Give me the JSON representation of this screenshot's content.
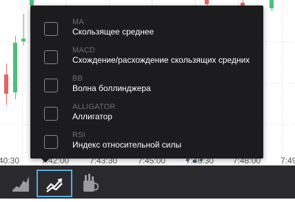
{
  "time_axis": {
    "ticks": [
      "40:30",
      "7:42:00",
      "7:43:30",
      "7:45:00",
      "7:46:30",
      "7:48:00",
      "7:49"
    ]
  },
  "indicator_menu": {
    "items": [
      {
        "code": "MA",
        "name": "Скользящее среднее",
        "checked": false
      },
      {
        "code": "MACD",
        "name": "Схождение/расхождение скользящих средних",
        "checked": false
      },
      {
        "code": "BB",
        "name": "Волна боллинджера",
        "checked": false
      },
      {
        "code": "ALLIGATOR",
        "name": "Аллигатор",
        "checked": false
      },
      {
        "code": "RSI",
        "name": "Индекс относительной силы",
        "checked": false
      }
    ]
  },
  "toolbar": {
    "buttons": [
      {
        "icon": "area-chart-icon",
        "active": false
      },
      {
        "icon": "indicators-icon",
        "active": true
      },
      {
        "icon": "drawing-tools-icon",
        "active": false
      }
    ]
  },
  "colors": {
    "bull_candle": "#4cbf7a",
    "bear_candle": "#e06666",
    "menu_bg": "#1c1c1f",
    "toolbar_bg": "#2a2a2e",
    "active_outline": "#5aaede"
  }
}
